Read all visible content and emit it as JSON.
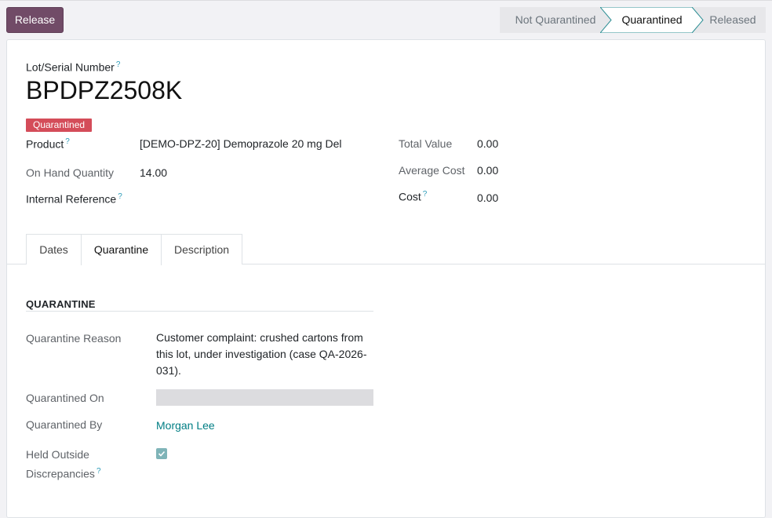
{
  "control": {
    "release_label": "Release"
  },
  "statusbar": {
    "stages": [
      "Not Quarantined",
      "Quarantined",
      "Released"
    ],
    "active_stage": "Quarantined"
  },
  "record": {
    "lot_label": "Lot/Serial Number",
    "lot_name": "BPDPZ2508K",
    "state_badge": "Quarantined",
    "product_label": "Product",
    "product_value": "[DEMO-DPZ-20] Demoprazole 20 mg Del",
    "on_hand_label": "On Hand Quantity",
    "on_hand_value": "14.00",
    "internal_ref_label": "Internal Reference",
    "internal_ref_value": "",
    "total_value_label": "Total Value",
    "total_value": "0.00",
    "avg_cost_label": "Average Cost",
    "avg_cost_value": "0.00",
    "cost_label": "Cost",
    "cost_value": "0.00",
    "help_mark": "?"
  },
  "tabs": [
    "Dates",
    "Quarantine",
    "Description"
  ],
  "active_tab": "Quarantine",
  "quarantine": {
    "section_title": "QUARANTINE",
    "reason_label": "Quarantine Reason",
    "reason_value": "Customer complaint: crushed cartons from this lot, under investigation (case QA-2026-031).",
    "on_label": "Quarantined On",
    "on_value": "",
    "by_label": "Quarantined By",
    "by_value": "Morgan Lee",
    "held_label_line1": "Held Outside",
    "held_label_line2": "Discrepancies",
    "held_checked": true
  },
  "colors": {
    "primary": "#714b67",
    "badge_danger": "#d44c59",
    "link": "#017e84",
    "help": "#2c9bb8"
  }
}
